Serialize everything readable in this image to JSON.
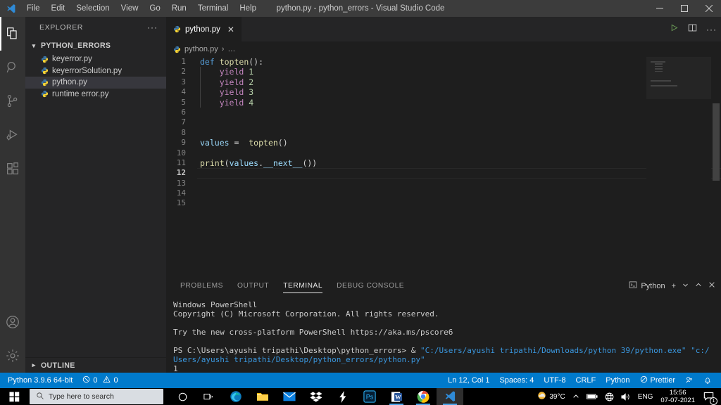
{
  "window": {
    "title": "python.py - python_errors - Visual Studio Code",
    "menu": [
      "File",
      "Edit",
      "Selection",
      "View",
      "Go",
      "Run",
      "Terminal",
      "Help"
    ],
    "controls": {
      "minimize": "─",
      "maximize": "☐",
      "close": "✕"
    }
  },
  "activitybar": {
    "items": [
      {
        "name": "explorer",
        "title": "Explorer"
      },
      {
        "name": "search",
        "title": "Search"
      },
      {
        "name": "source-control",
        "title": "Source Control"
      },
      {
        "name": "run-debug",
        "title": "Run and Debug"
      },
      {
        "name": "extensions",
        "title": "Extensions"
      }
    ],
    "bottom": [
      {
        "name": "accounts",
        "title": "Accounts"
      },
      {
        "name": "settings",
        "title": "Manage"
      }
    ]
  },
  "sidebar": {
    "header": "EXPLORER",
    "more_actions": "···",
    "folder": "PYTHON_ERRORS",
    "files": [
      {
        "label": "keyerror.py",
        "selected": false
      },
      {
        "label": "keyerrorSolution.py",
        "selected": false
      },
      {
        "label": "python.py",
        "selected": true
      },
      {
        "label": "runtime error.py",
        "selected": false
      }
    ],
    "outline": "OUTLINE"
  },
  "editor": {
    "tab": {
      "label": "python.py",
      "close": "✕"
    },
    "actions": {
      "run": "run-python-file",
      "split": "split-editor",
      "more": "···"
    },
    "breadcrumbs": [
      "python.py",
      "›",
      "…"
    ],
    "lines": [
      {
        "n": "1",
        "tokens": [
          {
            "t": "def ",
            "c": "kw"
          },
          {
            "t": "topten",
            "c": "fn"
          },
          {
            "t": "():",
            "c": "pn"
          }
        ],
        "indent": 0
      },
      {
        "n": "2",
        "tokens": [
          {
            "t": "    ",
            "c": "pn"
          },
          {
            "t": "yield ",
            "c": "kw2"
          },
          {
            "t": "1",
            "c": "num"
          }
        ],
        "indent": 1
      },
      {
        "n": "3",
        "tokens": [
          {
            "t": "    ",
            "c": "pn"
          },
          {
            "t": "yield ",
            "c": "kw2"
          },
          {
            "t": "2",
            "c": "num"
          }
        ],
        "indent": 1
      },
      {
        "n": "4",
        "tokens": [
          {
            "t": "    ",
            "c": "pn"
          },
          {
            "t": "yield ",
            "c": "kw2"
          },
          {
            "t": "3",
            "c": "num"
          }
        ],
        "indent": 1
      },
      {
        "n": "5",
        "tokens": [
          {
            "t": "    ",
            "c": "pn"
          },
          {
            "t": "yield ",
            "c": "kw2"
          },
          {
            "t": "4",
            "c": "num"
          }
        ],
        "indent": 1
      },
      {
        "n": "6",
        "tokens": [],
        "indent": 0
      },
      {
        "n": "7",
        "tokens": [],
        "indent": 0
      },
      {
        "n": "8",
        "tokens": [],
        "indent": 0
      },
      {
        "n": "9",
        "tokens": [
          {
            "t": "values ",
            "c": "var"
          },
          {
            "t": "= ",
            "c": "pn"
          },
          {
            "t": " topten",
            "c": "fn"
          },
          {
            "t": "()",
            "c": "pn"
          }
        ],
        "indent": 0
      },
      {
        "n": "10",
        "tokens": [],
        "indent": 0
      },
      {
        "n": "11",
        "tokens": [
          {
            "t": "print",
            "c": "fn"
          },
          {
            "t": "(",
            "c": "pn"
          },
          {
            "t": "values",
            "c": "var"
          },
          {
            "t": ".",
            "c": "pn"
          },
          {
            "t": "__next__",
            "c": "var"
          },
          {
            "t": "())",
            "c": "pn"
          }
        ],
        "indent": 0
      },
      {
        "n": "12",
        "tokens": [],
        "indent": 0,
        "active": true
      },
      {
        "n": "13",
        "tokens": [],
        "indent": 0
      },
      {
        "n": "14",
        "tokens": [],
        "indent": 0
      },
      {
        "n": "15",
        "tokens": [],
        "indent": 0
      }
    ]
  },
  "panel": {
    "tabs": [
      {
        "label": "PROBLEMS",
        "active": false
      },
      {
        "label": "OUTPUT",
        "active": false
      },
      {
        "label": "TERMINAL",
        "active": true
      },
      {
        "label": "DEBUG CONSOLE",
        "active": false
      }
    ],
    "shell_selector": "Python",
    "actions": {
      "new": "+",
      "dropdown": "∨",
      "maximize": "∧",
      "close": "✕"
    },
    "terminal_lines": [
      {
        "segments": [
          {
            "text": "Windows PowerShell",
            "cls": "t-white"
          }
        ]
      },
      {
        "segments": [
          {
            "text": "Copyright (C) Microsoft Corporation. All rights reserved.",
            "cls": "t-white"
          }
        ]
      },
      {
        "segments": [
          {
            "text": "",
            "cls": "t-white"
          }
        ]
      },
      {
        "segments": [
          {
            "text": "Try the new cross-platform PowerShell https://aka.ms/pscore6",
            "cls": "t-white"
          }
        ]
      },
      {
        "segments": [
          {
            "text": "",
            "cls": "t-white"
          }
        ]
      },
      {
        "segments": [
          {
            "text": "PS C:\\Users\\ayushi tripathi\\Desktop\\python_errors> & ",
            "cls": "t-white"
          },
          {
            "text": "\"C:/Users/ayushi tripathi/Downloads/python 39/python.exe\" \"c:/Users/ayushi tripathi/Desktop/python_errors/python.py\"",
            "cls": "t-path"
          }
        ]
      },
      {
        "segments": [
          {
            "text": "1",
            "cls": "t-white"
          }
        ]
      },
      {
        "segments": [
          {
            "text": "PS C:\\Users\\ayushi tripathi\\Desktop\\python_errors> ",
            "cls": "t-white"
          }
        ],
        "cursor": true
      }
    ]
  },
  "statusbar": {
    "left": [
      {
        "name": "python-version",
        "label": "Python 3.9.6 64-bit",
        "icon": ""
      },
      {
        "name": "errors-warnings",
        "label": "0",
        "icon": "error-icon",
        "label2": "0",
        "icon2": "warning-icon"
      }
    ],
    "python_version": "Python 3.9.6 64-bit",
    "errors": "0",
    "warnings": "0",
    "right": [
      {
        "name": "editor-position",
        "label": "Ln 12, Col 1"
      },
      {
        "name": "indentation",
        "label": "Spaces: 4"
      },
      {
        "name": "encoding",
        "label": "UTF-8"
      },
      {
        "name": "eol",
        "label": "CRLF"
      },
      {
        "name": "language-mode",
        "label": "Python"
      },
      {
        "name": "prettier",
        "label": "Prettier"
      }
    ],
    "accent": "#007acc"
  },
  "taskbar": {
    "search_placeholder": "Type here to search",
    "icons": [
      {
        "name": "cortana-icon"
      },
      {
        "name": "task-view-icon"
      },
      {
        "name": "microsoft-edge-icon"
      },
      {
        "name": "file-explorer-icon"
      },
      {
        "name": "mail-icon"
      },
      {
        "name": "dropbox-icon"
      },
      {
        "name": "lightning-icon"
      },
      {
        "name": "photoshop-icon"
      },
      {
        "name": "word-icon"
      },
      {
        "name": "chrome-icon"
      },
      {
        "name": "vscode-icon"
      }
    ],
    "tray": {
      "weather": "39°C",
      "language": "ENG",
      "time": "15:56",
      "date": "07-07-2021",
      "notification_count": "1"
    }
  }
}
